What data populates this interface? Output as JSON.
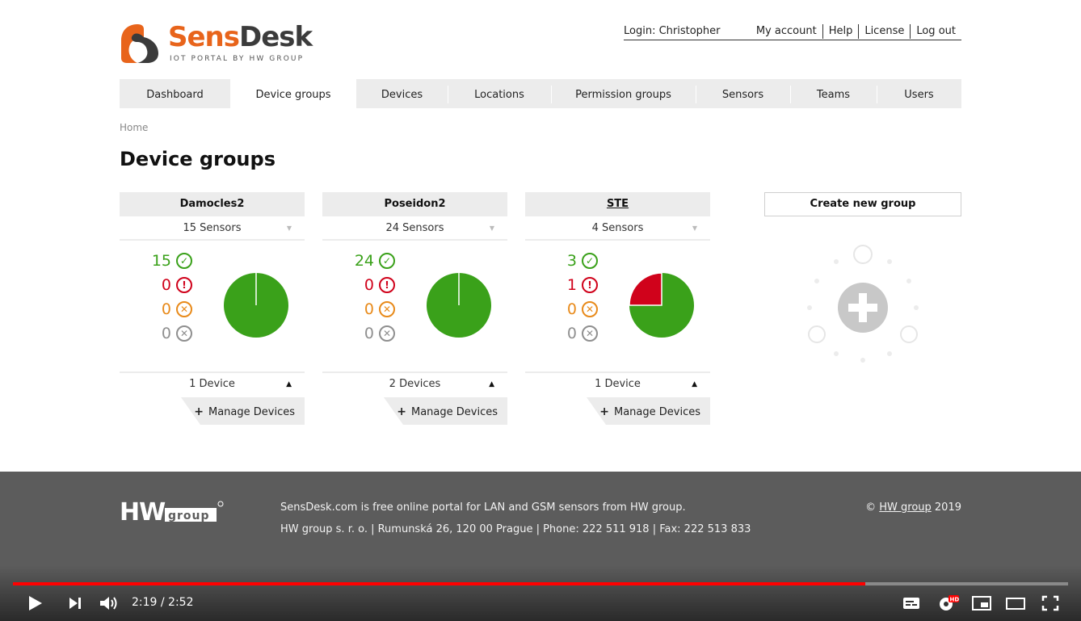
{
  "app": {
    "brand_a": "Sens",
    "brand_b": "Desk",
    "tagline": "IOT PORTAL BY HW GROUP",
    "accent": "#e8641b"
  },
  "topbar": {
    "login": "Login: Christopher",
    "links": [
      "My account",
      "Help",
      "License",
      "Log out"
    ]
  },
  "nav": {
    "tabs": [
      "Dashboard",
      "Device groups",
      "Devices",
      "Locations",
      "Permission groups",
      "Sensors",
      "Teams",
      "Users"
    ],
    "active": "Device groups"
  },
  "breadcrumb": "Home",
  "page_title": "Device groups",
  "groups": [
    {
      "name": "Damocles2",
      "sensors": "15 Sensors",
      "ok": "15",
      "error": "0",
      "warning": "0",
      "offline": "0",
      "devices": "1 Device",
      "manage": "Manage Devices",
      "ok_fraction": 1.0,
      "error_fraction": 0.0
    },
    {
      "name": "Poseidon2",
      "sensors": "24 Sensors",
      "ok": "24",
      "error": "0",
      "warning": "0",
      "offline": "0",
      "devices": "2 Devices",
      "manage": "Manage Devices",
      "ok_fraction": 1.0,
      "error_fraction": 0.0
    },
    {
      "name": "STE",
      "sensors": "4 Sensors",
      "ok": "3",
      "error": "1",
      "warning": "0",
      "offline": "0",
      "devices": "1 Device",
      "manage": "Manage Devices",
      "ok_fraction": 0.75,
      "error_fraction": 0.25
    }
  ],
  "create_group": "Create new group",
  "status_colors": {
    "ok": "#3aa11a",
    "error": "#d0021b",
    "warning": "#e88a1a",
    "offline": "#8f8f8f"
  },
  "footer": {
    "line1": "SensDesk.com is free online portal for LAN and GSM sensors from HW group.",
    "line2": "HW group s. r. o. | Rumunská 26, 120 00 Prague | Phone: 222 511 918 | Fax: 222 513 833",
    "copyright_prefix": "© ",
    "copyright_link": "HW group",
    "copyright_year": " 2019",
    "hw_logo_text": "HW",
    "hw_logo_sub": "group"
  },
  "video": {
    "time": "2:19 / 2:52",
    "progress": 0.808
  }
}
